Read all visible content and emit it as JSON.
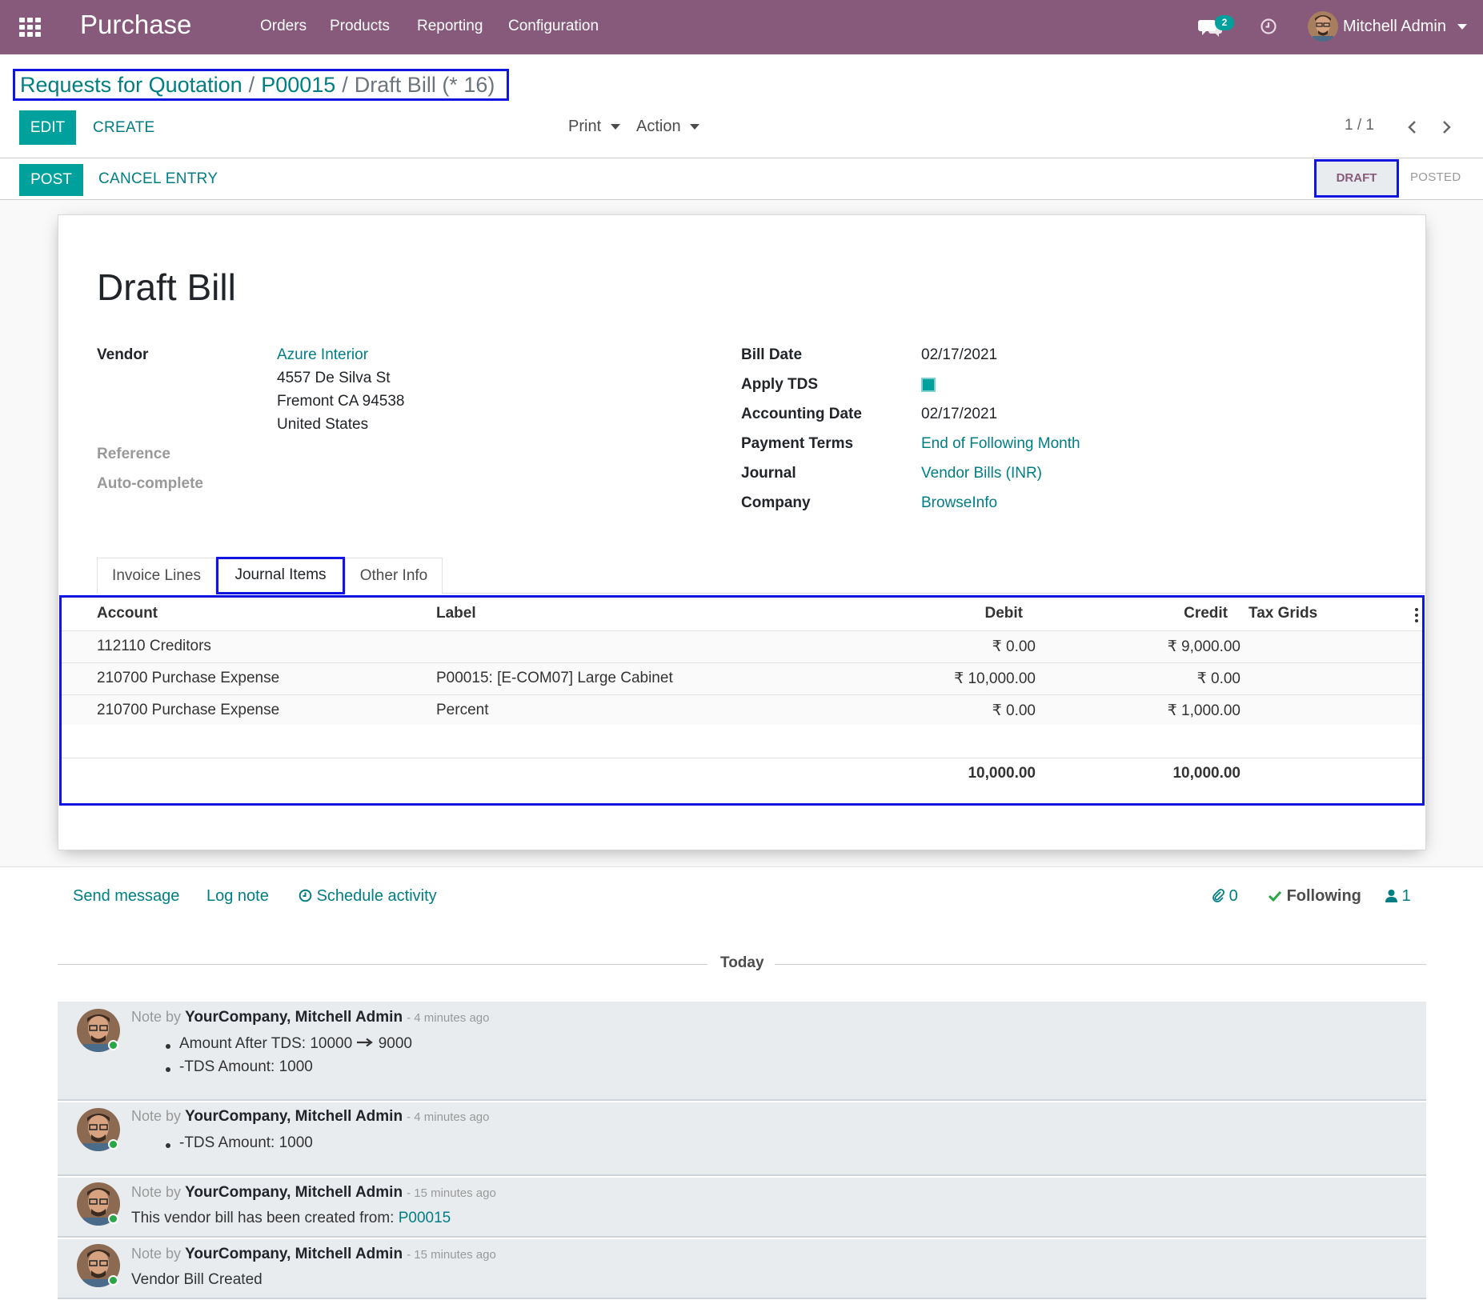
{
  "navbar": {
    "app_name": "Purchase",
    "menu": [
      "Orders",
      "Products",
      "Reporting",
      "Configuration"
    ],
    "messages_badge": "2",
    "user_name": "Mitchell Admin",
    "bg_color": "#875a7b"
  },
  "breadcrumb": {
    "items": [
      "Requests for Quotation",
      "P00015"
    ],
    "current": "Draft Bill (* 16)"
  },
  "control_panel": {
    "edit_label": "EDIT",
    "create_label": "CREATE",
    "print_label": "Print",
    "action_label": "Action",
    "pager": "1 / 1"
  },
  "statusbar": {
    "post_label": "POST",
    "cancel_label": "CANCEL ENTRY",
    "states": [
      "DRAFT",
      "POSTED"
    ],
    "active_state": "DRAFT"
  },
  "form": {
    "title": "Draft Bill",
    "vendor_label": "Vendor",
    "vendor_name": "Azure Interior",
    "vendor_address": [
      "4557 De Silva St",
      "Fremont CA 94538",
      "United States"
    ],
    "reference_label": "Reference",
    "autocomplete_label": "Auto-complete",
    "bill_date_label": "Bill Date",
    "bill_date": "02/17/2021",
    "apply_tds_label": "Apply TDS",
    "apply_tds_checked": true,
    "accounting_date_label": "Accounting Date",
    "accounting_date": "02/17/2021",
    "payment_terms_label": "Payment Terms",
    "payment_terms": "End of Following Month",
    "journal_label": "Journal",
    "journal": "Vendor Bills (INR)",
    "company_label": "Company",
    "company": "BrowseInfo"
  },
  "tabs": [
    "Invoice Lines",
    "Journal Items",
    "Other Info"
  ],
  "active_tab": "Journal Items",
  "journal_items": {
    "headers": [
      "Account",
      "Label",
      "Debit",
      "Credit",
      "Tax Grids"
    ],
    "rows": [
      {
        "account": "112110 Creditors",
        "label": "",
        "debit": "₹ 0.00",
        "credit": "₹ 9,000.00"
      },
      {
        "account": "210700 Purchase Expense",
        "label": "P00015: [E-COM07] Large Cabinet",
        "debit": "₹ 10,000.00",
        "credit": "₹ 0.00"
      },
      {
        "account": "210700 Purchase Expense",
        "label": "Percent",
        "debit": "₹ 0.00",
        "credit": "₹ 1,000.00"
      }
    ],
    "total_debit": "10,000.00",
    "total_credit": "10,000.00"
  },
  "chatter": {
    "send_message": "Send message",
    "log_note": "Log note",
    "schedule_activity": "Schedule activity",
    "attachments": "0",
    "following": "Following",
    "followers": "1",
    "date_separator": "Today",
    "messages": [
      {
        "prefix": "Note by",
        "author": "YourCompany, Mitchell Admin",
        "time": "- 4 minutes ago",
        "bullets": [
          "Amount After TDS: 10000",
          "9000",
          "-TDS Amount: 1000"
        ]
      },
      {
        "prefix": "Note by",
        "author": "YourCompany, Mitchell Admin",
        "time": "- 4 minutes ago",
        "bullets": [
          "-TDS Amount: 1000"
        ]
      },
      {
        "prefix": "Note by",
        "author": "YourCompany, Mitchell Admin",
        "time": "- 15 minutes ago",
        "text": "This vendor bill has been created from:",
        "link": "P00015"
      },
      {
        "prefix": "Note by",
        "author": "YourCompany, Mitchell Admin",
        "time": "- 15 minutes ago",
        "text": "Vendor Bill Created"
      }
    ]
  }
}
